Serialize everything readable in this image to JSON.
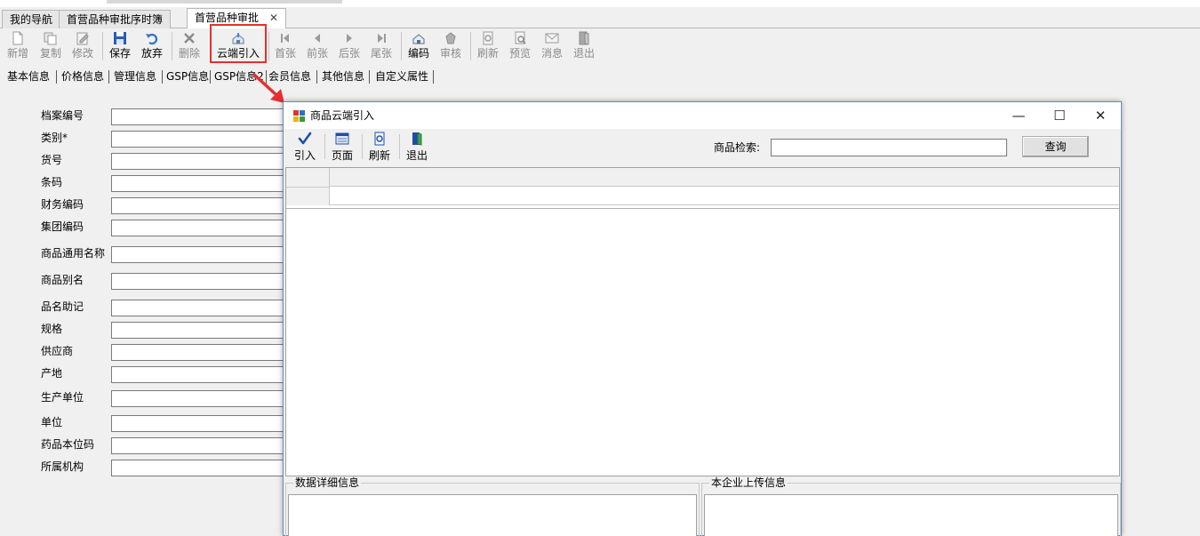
{
  "tabs": [
    {
      "label": "我的导航"
    },
    {
      "label": "首营品种审批序时簿"
    },
    {
      "label": "首营品种审批",
      "close": "✕"
    }
  ],
  "toolbar": {
    "items": [
      {
        "label": "新增",
        "icon": "new-doc-icon",
        "enabled": false
      },
      {
        "label": "复制",
        "icon": "copy-icon",
        "enabled": false
      },
      {
        "label": "修改",
        "icon": "edit-icon",
        "enabled": false
      },
      {
        "label": "保存",
        "icon": "save-icon",
        "enabled": true
      },
      {
        "label": "放弃",
        "icon": "undo-icon",
        "enabled": true
      },
      {
        "label": "删除",
        "icon": "delete-icon",
        "enabled": false
      },
      {
        "label": "云端引入",
        "icon": "cloud-import-icon",
        "enabled": true
      },
      {
        "label": "首张",
        "icon": "first-icon",
        "enabled": false
      },
      {
        "label": "前张",
        "icon": "prev-icon",
        "enabled": false
      },
      {
        "label": "后张",
        "icon": "next-icon",
        "enabled": false
      },
      {
        "label": "尾张",
        "icon": "last-icon",
        "enabled": false
      },
      {
        "label": "编码",
        "icon": "code-icon",
        "enabled": true
      },
      {
        "label": "审核",
        "icon": "audit-icon",
        "enabled": false
      },
      {
        "label": "刷新",
        "icon": "refresh-icon",
        "enabled": false
      },
      {
        "label": "预览",
        "icon": "preview-icon",
        "enabled": false
      },
      {
        "label": "消息",
        "icon": "message-icon",
        "enabled": false
      },
      {
        "label": "退出",
        "icon": "exit-icon",
        "enabled": false
      }
    ]
  },
  "subtabs": [
    "基本信息",
    "价格信息",
    "管理信息",
    "GSP信息",
    "GSP信息2",
    "会员信息",
    "其他信息",
    "自定义属性"
  ],
  "form": {
    "fields": [
      {
        "label": "档案编号",
        "value": ""
      },
      {
        "label": "类别*",
        "value": ""
      },
      {
        "label": "货号",
        "value": ""
      },
      {
        "label": "条码",
        "value": ""
      },
      {
        "label": "财务编码",
        "value": ""
      },
      {
        "label": "集团编码",
        "value": ""
      },
      {
        "label": "商品通用名称",
        "value": ""
      },
      {
        "label": "商品别名",
        "value": ""
      },
      {
        "label": "品名助记",
        "value": ""
      },
      {
        "label": "规格",
        "value": ""
      },
      {
        "label": "供应商",
        "value": ""
      },
      {
        "label": "产地",
        "value": ""
      },
      {
        "label": "生产单位",
        "value": ""
      },
      {
        "label": "单位",
        "value": ""
      },
      {
        "label": "药品本位码",
        "value": ""
      },
      {
        "label": "所属机构",
        "value": ""
      }
    ]
  },
  "dialog": {
    "title": "商品云端引入",
    "controls": {
      "minimize": "—",
      "maximize": "☐",
      "close": "✕"
    },
    "toolbar": [
      {
        "label": "引入",
        "icon": "check-icon"
      },
      {
        "label": "页面",
        "icon": "page-icon"
      },
      {
        "label": "刷新",
        "icon": "refresh-icon"
      },
      {
        "label": "退出",
        "icon": "exit-icon"
      }
    ],
    "search_label": "商品检索:",
    "search_value": "",
    "query_button": "查询",
    "group_left": "数据详细信息",
    "group_right": "本企业上传信息"
  },
  "colors": {
    "highlight_border": "#e53030",
    "arrow": "#e53030",
    "window_bg": "#f0f0f0"
  }
}
